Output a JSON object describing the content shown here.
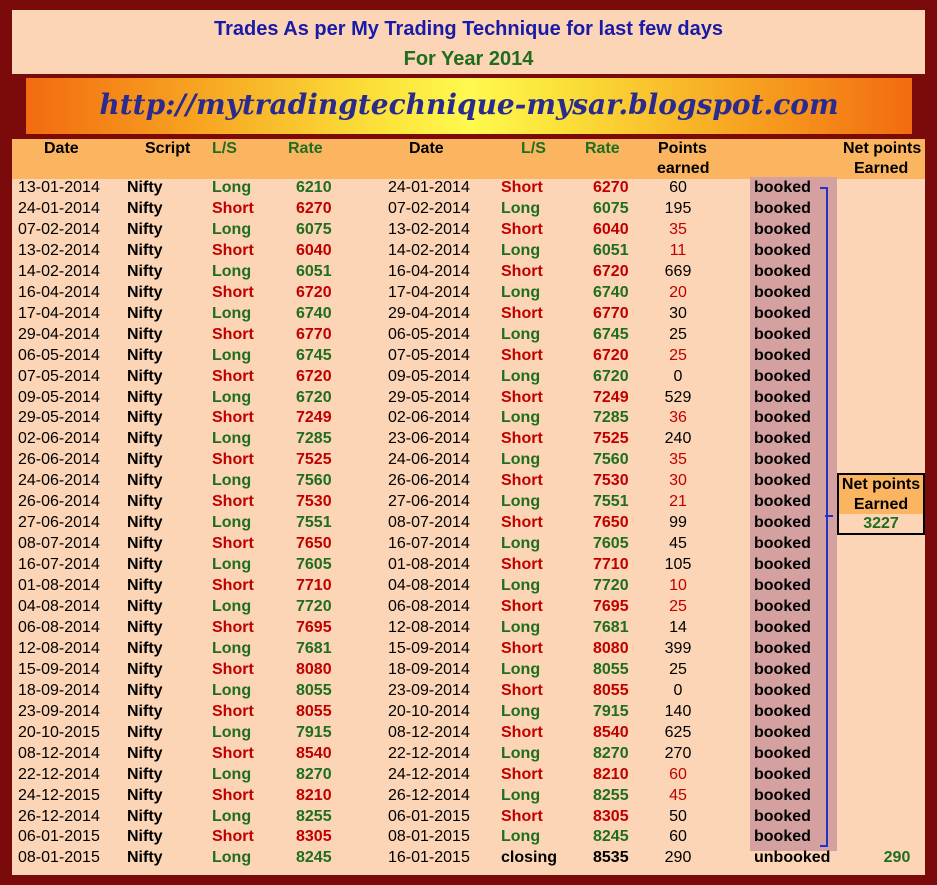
{
  "title": "Trades As per My Trading Technique for last few days",
  "subtitle": "For Year 2014",
  "banner_url": "http://mytradingtechnique-mysar.blogspot.com",
  "headers": {
    "date1": "Date",
    "script": "Script",
    "ls1": "L/S",
    "rate1": "Rate",
    "date2": "Date",
    "ls2": "L/S",
    "rate2": "Rate",
    "points_1": "Points",
    "points_2": "earned",
    "net_1": "Net points",
    "net_2": "Earned"
  },
  "net_box": {
    "label_1": "Net points",
    "label_2": "Earned",
    "value": "3227"
  },
  "trades": [
    [
      "13-01-2014",
      "Nifty",
      "Long",
      "6210",
      "24-01-2014",
      "Short",
      "6270",
      "60",
      "booked"
    ],
    [
      "24-01-2014",
      "Nifty",
      "Short",
      "6270",
      "07-02-2014",
      "Long",
      "6075",
      "195",
      "booked"
    ],
    [
      "07-02-2014",
      "Nifty",
      "Long",
      "6075",
      "13-02-2014",
      "Short",
      "6040",
      "35",
      "booked"
    ],
    [
      "13-02-2014",
      "Nifty",
      "Short",
      "6040",
      "14-02-2014",
      "Long",
      "6051",
      "11",
      "booked"
    ],
    [
      "14-02-2014",
      "Nifty",
      "Long",
      "6051",
      "16-04-2014",
      "Short",
      "6720",
      "669",
      "booked"
    ],
    [
      "16-04-2014",
      "Nifty",
      "Short",
      "6720",
      "17-04-2014",
      "Long",
      "6740",
      "20",
      "booked"
    ],
    [
      "17-04-2014",
      "Nifty",
      "Long",
      "6740",
      "29-04-2014",
      "Short",
      "6770",
      "30",
      "booked"
    ],
    [
      "29-04-2014",
      "Nifty",
      "Short",
      "6770",
      "06-05-2014",
      "Long",
      "6745",
      "25",
      "booked"
    ],
    [
      "06-05-2014",
      "Nifty",
      "Long",
      "6745",
      "07-05-2014",
      "Short",
      "6720",
      "25",
      "booked"
    ],
    [
      "07-05-2014",
      "Nifty",
      "Short",
      "6720",
      "09-05-2014",
      "Long",
      "6720",
      "0",
      "booked"
    ],
    [
      "09-05-2014",
      "Nifty",
      "Long",
      "6720",
      "29-05-2014",
      "Short",
      "7249",
      "529",
      "booked"
    ],
    [
      "29-05-2014",
      "Nifty",
      "Short",
      "7249",
      "02-06-2014",
      "Long",
      "7285",
      "36",
      "booked"
    ],
    [
      "02-06-2014",
      "Nifty",
      "Long",
      "7285",
      "23-06-2014",
      "Short",
      "7525",
      "240",
      "booked"
    ],
    [
      "26-06-2014",
      "Nifty",
      "Short",
      "7525",
      "24-06-2014",
      "Long",
      "7560",
      "35",
      "booked"
    ],
    [
      "24-06-2014",
      "Nifty",
      "Long",
      "7560",
      "26-06-2014",
      "Short",
      "7530",
      "30",
      "booked"
    ],
    [
      "26-06-2014",
      "Nifty",
      "Short",
      "7530",
      "27-06-2014",
      "Long",
      "7551",
      "21",
      "booked"
    ],
    [
      "27-06-2014",
      "Nifty",
      "Long",
      "7551",
      "08-07-2014",
      "Short",
      "7650",
      "99",
      "booked"
    ],
    [
      "08-07-2014",
      "Nifty",
      "Short",
      "7650",
      "16-07-2014",
      "Long",
      "7605",
      "45",
      "booked"
    ],
    [
      "16-07-2014",
      "Nifty",
      "Long",
      "7605",
      "01-08-2014",
      "Short",
      "7710",
      "105",
      "booked"
    ],
    [
      "01-08-2014",
      "Nifty",
      "Short",
      "7710",
      "04-08-2014",
      "Long",
      "7720",
      "10",
      "booked"
    ],
    [
      "04-08-2014",
      "Nifty",
      "Long",
      "7720",
      "06-08-2014",
      "Short",
      "7695",
      "25",
      "booked"
    ],
    [
      "06-08-2014",
      "Nifty",
      "Short",
      "7695",
      "12-08-2014",
      "Long",
      "7681",
      "14",
      "booked"
    ],
    [
      "12-08-2014",
      "Nifty",
      "Long",
      "7681",
      "15-09-2014",
      "Short",
      "8080",
      "399",
      "booked"
    ],
    [
      "15-09-2014",
      "Nifty",
      "Short",
      "8080",
      "18-09-2014",
      "Long",
      "8055",
      "25",
      "booked"
    ],
    [
      "18-09-2014",
      "Nifty",
      "Long",
      "8055",
      "23-09-2014",
      "Short",
      "8055",
      "0",
      "booked"
    ],
    [
      "23-09-2014",
      "Nifty",
      "Short",
      "8055",
      "20-10-2014",
      "Long",
      "7915",
      "140",
      "booked"
    ],
    [
      "20-10-2015",
      "Nifty",
      "Long",
      "7915",
      "08-12-2014",
      "Short",
      "8540",
      "625",
      "booked"
    ],
    [
      "08-12-2014",
      "Nifty",
      "Short",
      "8540",
      "22-12-2014",
      "Long",
      "8270",
      "270",
      "booked"
    ],
    [
      "22-12-2014",
      "Nifty",
      "Long",
      "8270",
      "24-12-2014",
      "Short",
      "8210",
      "60",
      "booked"
    ],
    [
      "24-12-2015",
      "Nifty",
      "Short",
      "8210",
      "26-12-2014",
      "Long",
      "8255",
      "45",
      "booked"
    ],
    [
      "26-12-2014",
      "Nifty",
      "Long",
      "8255",
      "06-01-2015",
      "Short",
      "8305",
      "50",
      "booked"
    ],
    [
      "06-01-2015",
      "Nifty",
      "Short",
      "8305",
      "08-01-2015",
      "Long",
      "8245",
      "60",
      "booked"
    ],
    [
      "08-01-2015",
      "Nifty",
      "Long",
      "8245",
      "16-01-2015",
      "closing",
      "8535",
      "290",
      "unbooked",
      "290"
    ]
  ],
  "colors": {
    "long": "#1f6e1f",
    "short": "#c00000",
    "closing": "#000000",
    "loss_points": "#c00000"
  }
}
